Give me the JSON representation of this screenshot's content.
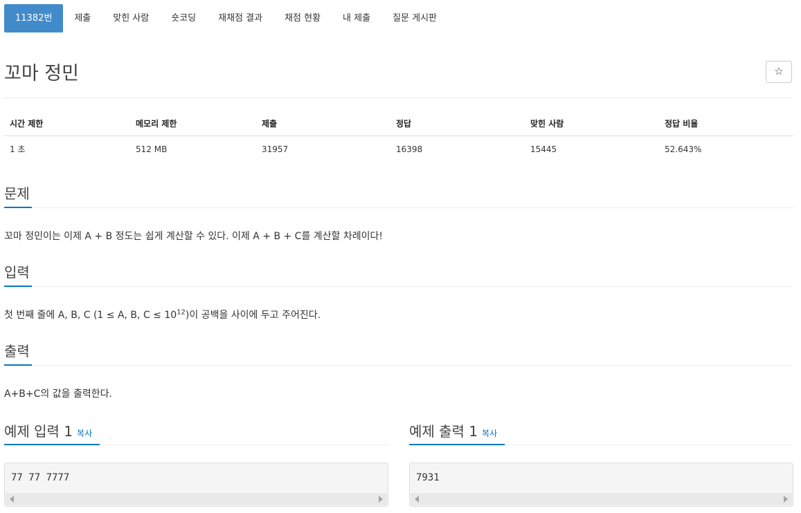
{
  "tabs": [
    {
      "label": "11382번"
    },
    {
      "label": "제출"
    },
    {
      "label": "맞힌 사람"
    },
    {
      "label": "숏코딩"
    },
    {
      "label": "재채점 결과"
    },
    {
      "label": "채점 현황"
    },
    {
      "label": "내 제출"
    },
    {
      "label": "질문 게시판"
    }
  ],
  "problem": {
    "title": "꼬마 정민",
    "star_icon": "☆"
  },
  "stats": {
    "headers": [
      "시간 제한",
      "메모리 제한",
      "제출",
      "정답",
      "맞힌 사람",
      "정답 비율"
    ],
    "values": [
      "1 초",
      "512 MB",
      "31957",
      "16398",
      "15445",
      "52.643%"
    ]
  },
  "sections": {
    "problem": {
      "title": "문제",
      "text": "꼬마 정민이는 이제 A + B 정도는 쉽게 계산할 수 있다. 이제 A + B + C를 계산할 차례이다!"
    },
    "input": {
      "title": "입력",
      "text_before": "첫 번째 줄에 A, B, C (1 ≤ A, B, C ≤ 10",
      "text_sup": "12",
      "text_after": ")이 공백을 사이에 두고 주어진다."
    },
    "output": {
      "title": "출력",
      "text": "A+B+C의 값을 출력한다."
    }
  },
  "examples": {
    "input": {
      "title": "예제 입력 1",
      "copy_label": "복사",
      "content": "77 77 7777"
    },
    "output": {
      "title": "예제 출력 1",
      "copy_label": "복사",
      "content": "7931"
    }
  },
  "colors": {
    "accent": "#428bca",
    "link": "#0076c0"
  }
}
